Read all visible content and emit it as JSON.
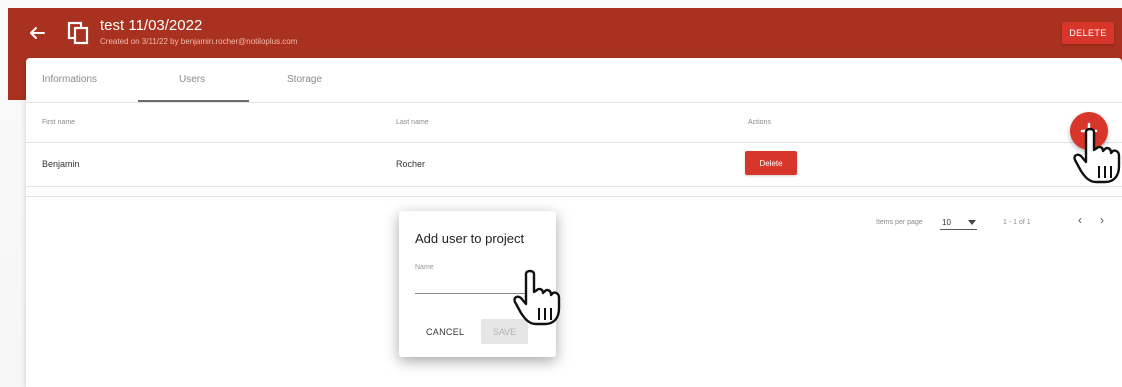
{
  "header": {
    "title": "test 11/03/2022",
    "subtitle": "Created on 3/11/22 by benjamin.rocher@notiloplus.com",
    "delete_label": "DELETE",
    "back_icon": "arrow-left-icon",
    "project_icon": "copy-icon",
    "color": "#a8321f"
  },
  "tabs": [
    {
      "label": "Informations",
      "active": false
    },
    {
      "label": "Users",
      "active": true
    },
    {
      "label": "Storage",
      "active": false
    }
  ],
  "table": {
    "columns": [
      "First name",
      "Last name",
      "Actions"
    ],
    "rows": [
      {
        "first_name": "Benjamin",
        "last_name": "Rocher",
        "action_label": "Delete"
      }
    ],
    "add_button_icon": "plus-icon"
  },
  "pagination": {
    "items_per_page_label": "Items per page",
    "items_per_page_value": "10",
    "range": "1 - 1 of 1"
  },
  "dialog": {
    "title": "Add user to project",
    "name_label": "Name",
    "name_value": "",
    "cancel_label": "CANCEL",
    "save_label": "SAVE"
  },
  "colors": {
    "accent": "#d8362b",
    "header": "#a8321f"
  }
}
